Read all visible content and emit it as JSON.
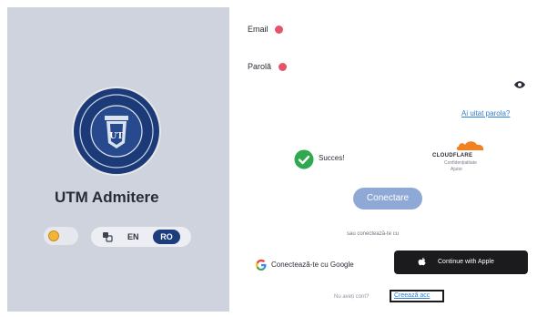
{
  "brand": {
    "title": "UTM Admitere"
  },
  "language": {
    "en": "EN",
    "ro": "RO",
    "active": "RO"
  },
  "form": {
    "email_label": "Email",
    "password_label": "Parolă",
    "forgot_link": "Ai uitat parola?",
    "captcha_status": "Succes!",
    "captcha_provider": "CLOUDFLARE",
    "captcha_privacy": "Confidențialitate",
    "captcha_help": "Ajutor",
    "login_button": "Conectare",
    "or_text": "sau conectează-te cu",
    "google_button": "Conectează-te cu Google",
    "apple_button": "Continue with Apple",
    "no_account_text": "Nu aveți cont?",
    "create_account_link": "Creează acc"
  },
  "colors": {
    "brand_navy": "#1d3c7c",
    "required_dot": "#e5546a",
    "link": "#2f7fd6",
    "success": "#2fa84f",
    "cloudflare_orange": "#f48120"
  }
}
